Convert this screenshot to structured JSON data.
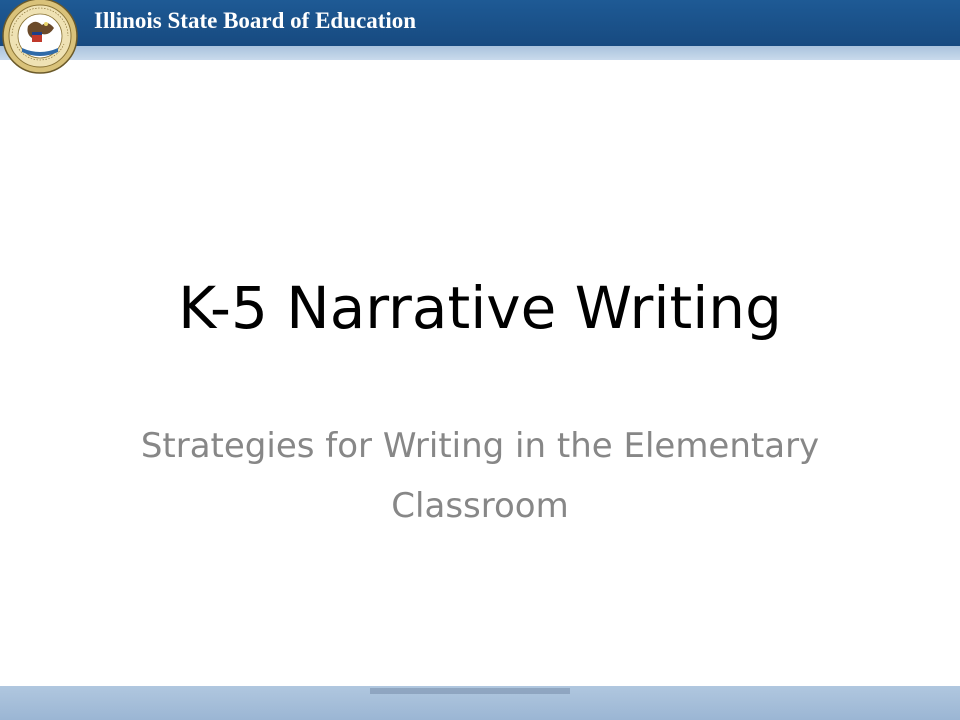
{
  "header": {
    "organization": "Illinois State Board of Education",
    "seal_text": "SEAL OF THE STATE OF ILLINOIS · AUG. 26TH 1818",
    "bar_color": "#1e5a95",
    "stripe_color": "#b9cfe6"
  },
  "slide": {
    "title": "K-5 Narrative Writing",
    "subtitle": "Strategies for Writing in the Elementary Classroom",
    "subtitle_color": "#878787"
  },
  "footer": {
    "bar_color": "#a9c1dc"
  }
}
